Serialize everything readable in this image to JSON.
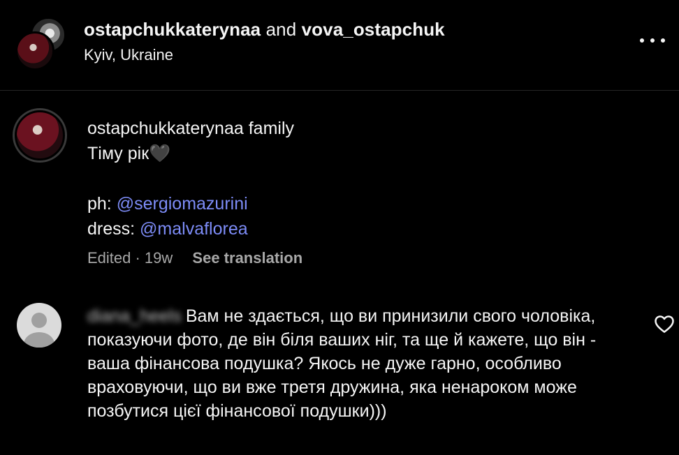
{
  "post": {
    "author1": "ostapchukkaterynaa",
    "joiner": "and",
    "author2": "vova_ostapchuk",
    "location": "Kyiv, Ukraine"
  },
  "caption": {
    "author": "ostapchukkaterynaa",
    "first_line_rest": "family",
    "line2": "Тіму рік🖤",
    "ph_label": "ph:",
    "ph_mention": "@sergiomazurini",
    "dress_label": "dress:",
    "dress_mention": "@malvaflorea",
    "meta_edited": "Edited · 19w",
    "see_translation": "See translation"
  },
  "comment": {
    "username_obscured": "diana_heels",
    "text": "Вам не здається, що ви принизили свого чоловіка, показуючи фото, де він біля ваших ніг, та ще й кажете, що він - ваша фінансова подушка? Якось не дуже гарно, особливо враховуючи, що ви вже третя дружина, яка ненароком може позбутися цієї фінансової подушки)))"
  },
  "icons": {
    "more": "more-horizontal-icon",
    "like": "heart-outline-icon"
  },
  "colors": {
    "background": "#000000",
    "text": "#f5f5f5",
    "secondary_text": "#a8a8a8",
    "mention": "#7d8cf7"
  }
}
